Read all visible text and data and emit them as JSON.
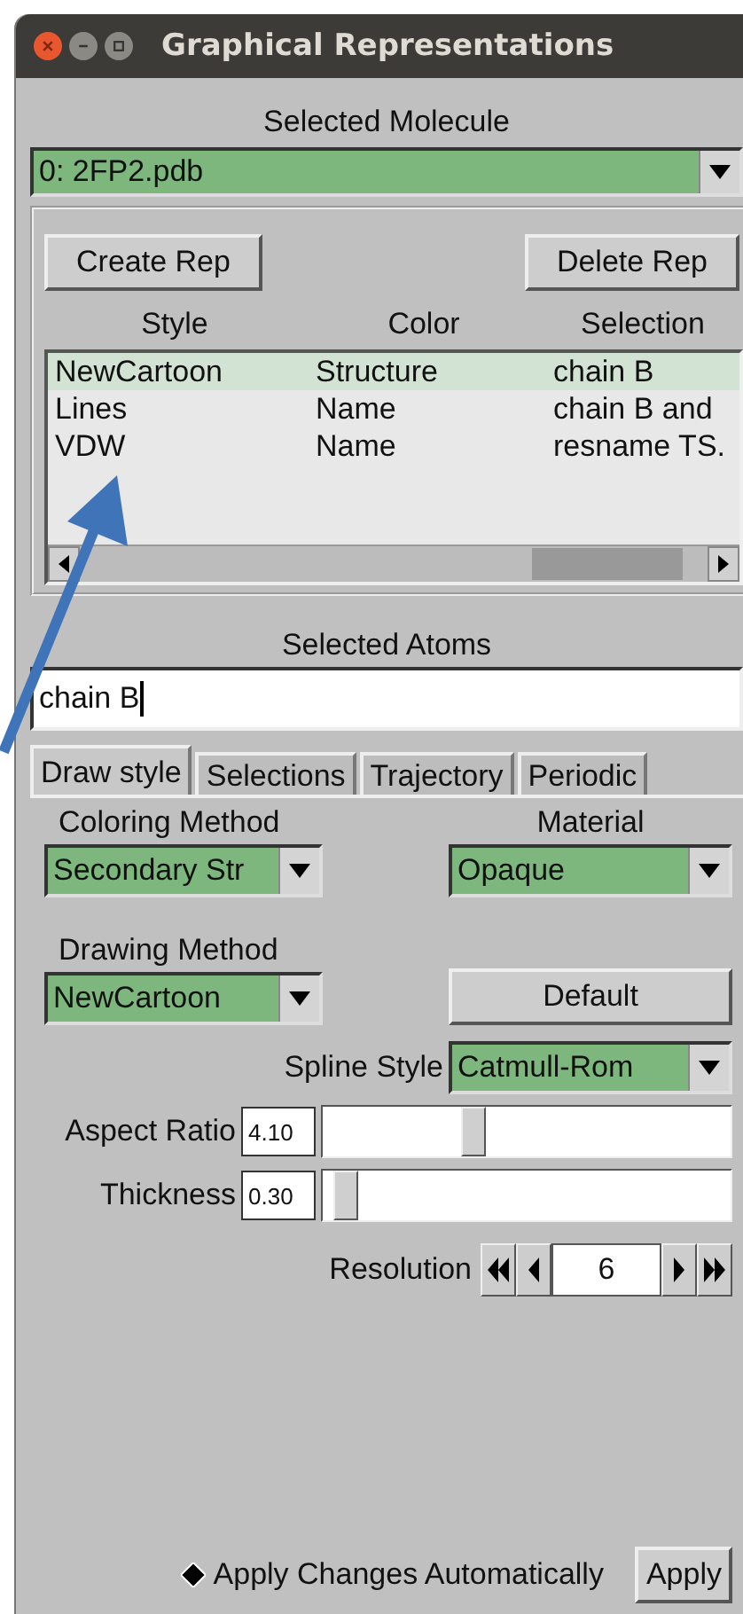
{
  "window": {
    "title": "Graphical Representations"
  },
  "selected_molecule": {
    "label": "Selected Molecule",
    "value": "0: 2FP2.pdb"
  },
  "rep_buttons": [
    "Create Rep",
    "Delete Rep"
  ],
  "reps": {
    "columns": [
      "Style",
      "Color",
      "Selection"
    ],
    "rows": [
      {
        "cells": [
          "NewCartoon",
          "Structure",
          "chain B"
        ],
        "selected": true
      },
      {
        "cells": [
          "Lines",
          "Name",
          "chain B and"
        ],
        "selected": false
      },
      {
        "cells": [
          "VDW",
          "Name",
          "resname TS."
        ],
        "selected": false
      }
    ]
  },
  "selected_atoms": {
    "label": "Selected Atoms",
    "value": "chain B"
  },
  "tabs": [
    {
      "label": "Draw style",
      "selected": true
    },
    {
      "label": "Selections",
      "selected": false
    },
    {
      "label": "Trajectory",
      "selected": false
    },
    {
      "label": "Periodic",
      "selected": false
    }
  ],
  "coloring_method": {
    "label": "Coloring Method",
    "value": "Secondary Str"
  },
  "material": {
    "label": "Material",
    "value": "Opaque"
  },
  "drawing_method": {
    "label": "Drawing Method",
    "value": "NewCartoon"
  },
  "default_button": "Default",
  "settings": [
    {
      "kind": "dropdown",
      "label": "Spline Style",
      "value": "Catmull-Rom"
    },
    {
      "kind": "slider",
      "label": "Aspect Ratio",
      "value": "4.10",
      "level": 0.36
    },
    {
      "kind": "slider",
      "label": "Thickness",
      "value": "0.30",
      "level": 0.03
    },
    {
      "kind": "counter",
      "label": "Resolution",
      "value": "6"
    }
  ],
  "apply_auto": {
    "label": "Apply Changes Automatically",
    "checked": true
  },
  "apply_button": "Apply"
}
